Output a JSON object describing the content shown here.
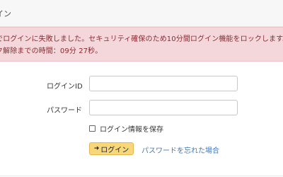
{
  "header": {
    "title": "イン"
  },
  "alert": {
    "line1": "でログインに失敗しました。セキュリティ確保のため10分間ログイン機能をロックします。",
    "line2": "ク解除までの時間：09分 27秒。"
  },
  "form": {
    "login_id_label": "ログインID",
    "password_label": "パスワード",
    "login_id_value": "",
    "password_value": "",
    "remember_label": "ログイン情報を保存",
    "remember_checked": false,
    "login_button_label": "ログイン",
    "login_button_icon": "sign-in-icon",
    "forgot_link": "パスワードを忘れた場合"
  },
  "colors": {
    "alert_bg": "#f4d7da",
    "alert_text": "#8b2a33",
    "button_bg": "#f8d77b",
    "link": "#3b7ac7"
  }
}
